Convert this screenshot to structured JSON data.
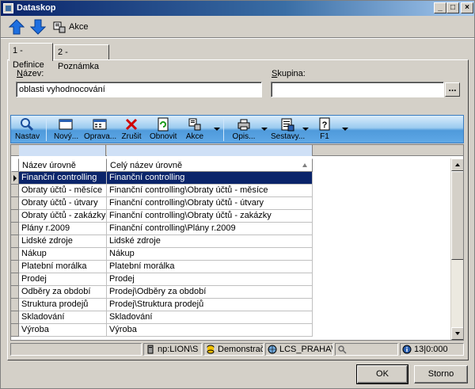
{
  "window": {
    "title": "Dataskop"
  },
  "topbar": {
    "akce_label": "Akce"
  },
  "tabs": [
    {
      "label": "1 - Definice",
      "active": true
    },
    {
      "label": "2 - Poznámka",
      "active": false
    }
  ],
  "form": {
    "nazev_label_u": "N",
    "nazev_label_rest": "ázev:",
    "nazev_value": "oblasti vyhodnocování",
    "skupina_label_u": "S",
    "skupina_label_rest": "kupina:",
    "skupina_value": "",
    "browse_label": "..."
  },
  "toolbar": {
    "nastav": "Nastav",
    "novy": "Nový...",
    "oprava": "Oprava...",
    "zrusit": "Zrušit",
    "obnovit": "Obnovit",
    "akce": "Akce",
    "opis": "Opis...",
    "sestavy": "Sestavy...",
    "f1": "F1"
  },
  "grid": {
    "columns": [
      "Název úrovně",
      "Celý název úrovně"
    ],
    "rows": [
      [
        "Finanční controlling",
        "Finanční controlling"
      ],
      [
        "Obraty účtů - měsíce",
        "Finanční controlling\\Obraty účtů - měsíce"
      ],
      [
        "Obraty účtů - útvary",
        "Finanční controlling\\Obraty účtů - útvary"
      ],
      [
        "Obraty účtů - zakázky",
        "Finanční controlling\\Obraty účtů - zakázky"
      ],
      [
        "Plány r.2009",
        "Finanční controlling\\Plány r.2009"
      ],
      [
        "Lidské zdroje",
        "Lidské zdroje"
      ],
      [
        "Nákup",
        "Nákup"
      ],
      [
        "Platební morálka",
        "Platební morálka"
      ],
      [
        "Prodej",
        "Prodej"
      ],
      [
        "Odběry za období",
        "Prodej\\Odběry za období"
      ],
      [
        "Struktura prodejů",
        "Prodej\\Struktura prodejů"
      ],
      [
        "Skladování",
        "Skladování"
      ],
      [
        "Výroba",
        "Výroba"
      ]
    ],
    "selected_row": 0
  },
  "statusbar": {
    "server": "np:LION\\S",
    "database": "Demonstrační",
    "company": "LCS_PRAHA\\k",
    "counter": "13|0:000"
  },
  "buttons": {
    "ok": "OK",
    "storno": "Storno"
  },
  "colors": {
    "selection": "#0a246a",
    "toolbar_top": "#d9ecfb",
    "toolbar_bottom": "#5fa8e6"
  }
}
